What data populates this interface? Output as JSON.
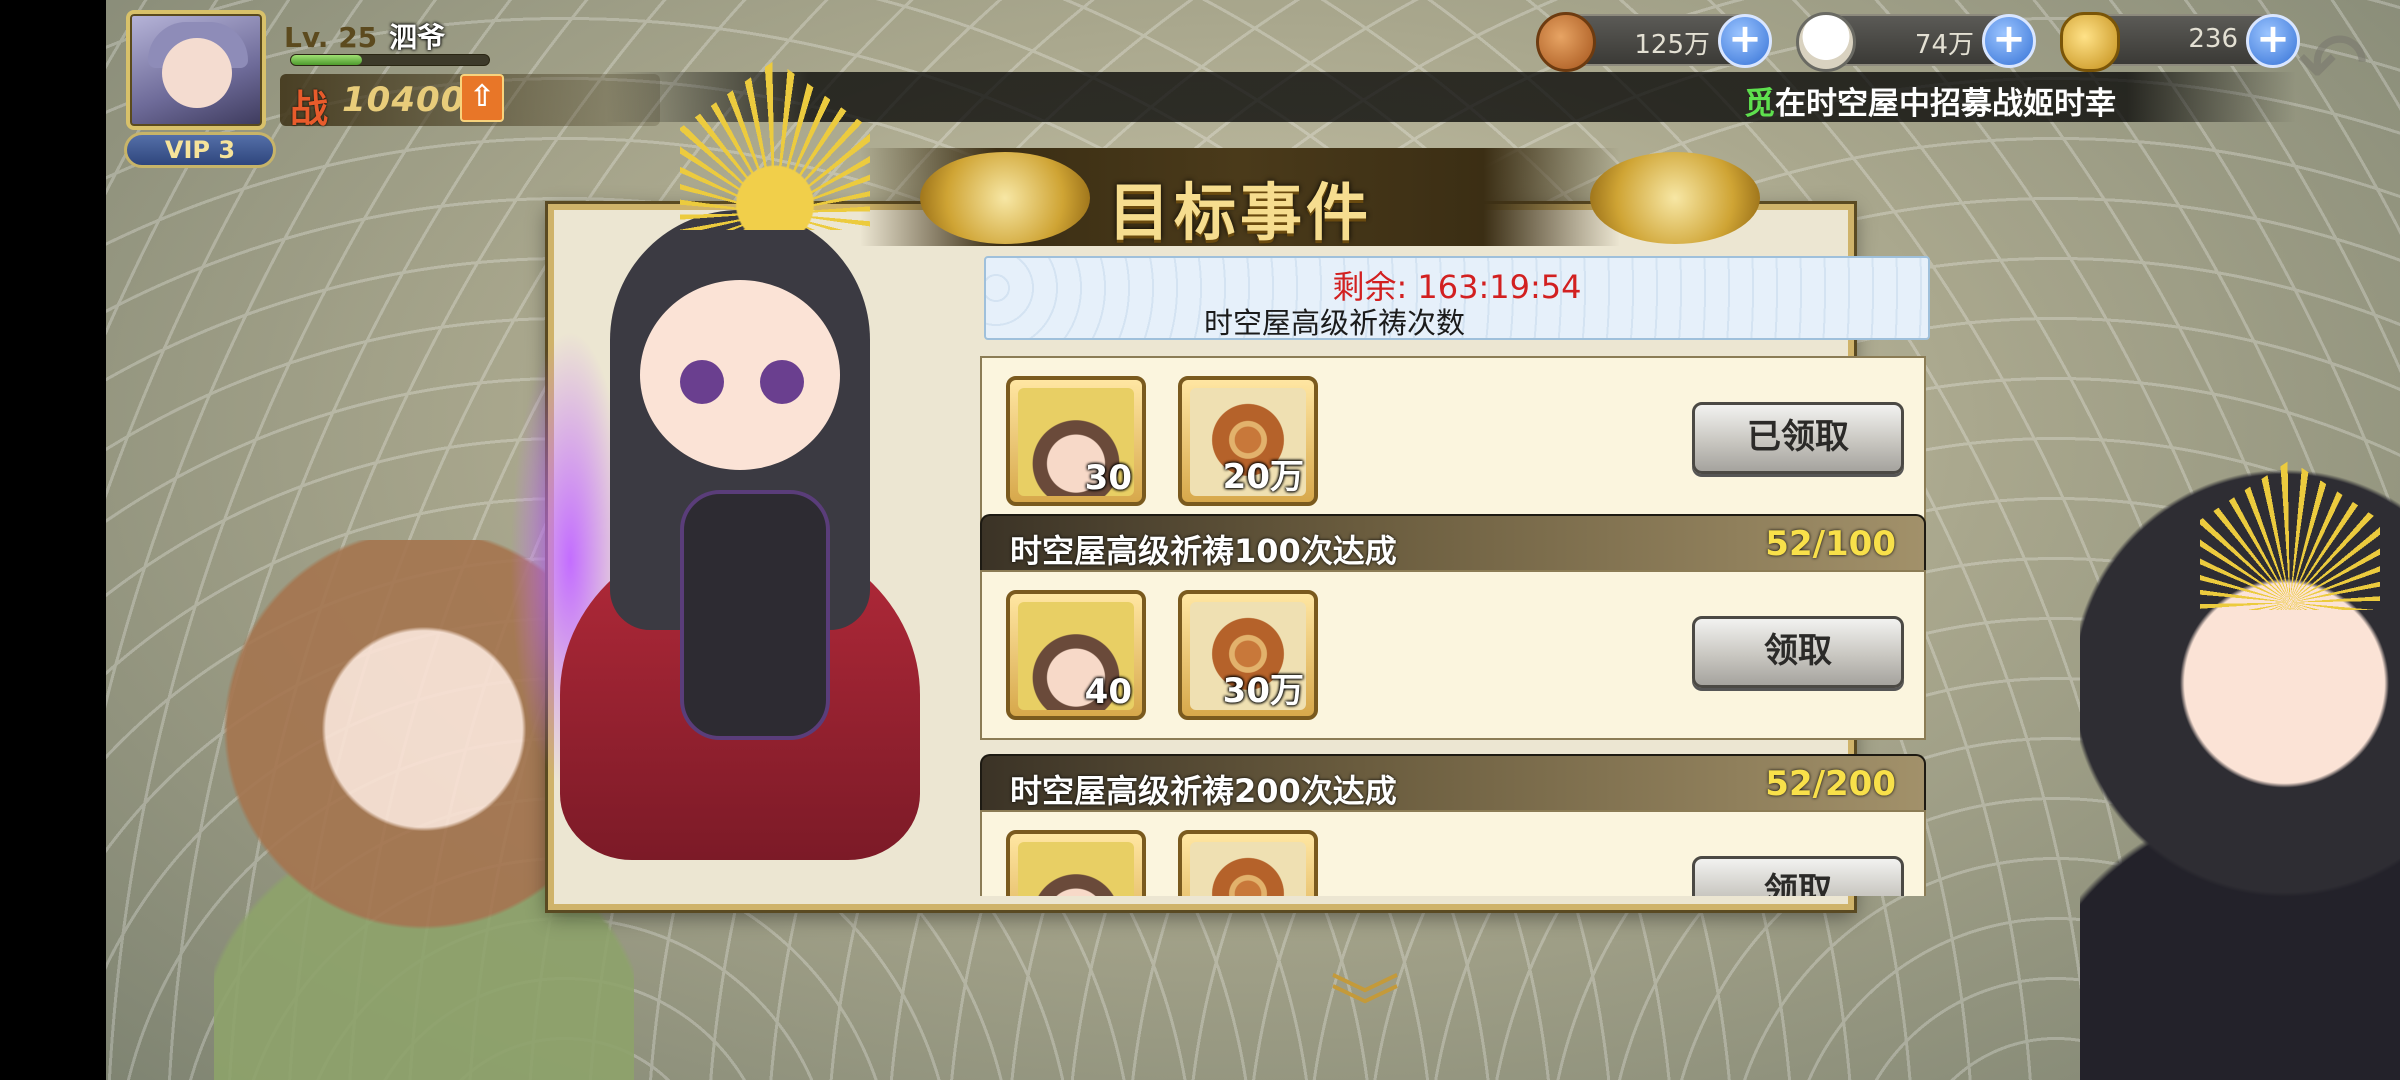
{
  "player": {
    "level_label": "Lv. 25",
    "name": "泗爷",
    "vip": "VIP 3",
    "power_icon": "战",
    "power_value": "104005",
    "exp_progress": 0.36
  },
  "resources": {
    "coins": "125万",
    "rice": "74万",
    "gold": "236"
  },
  "marquee": {
    "highlight": "觅",
    "text": "在时空屋中招募战姬时幸"
  },
  "dialog": {
    "title": "目标事件",
    "timer": "剩余: 163:19:54",
    "subtitle": "时空屋高级祈祷次数"
  },
  "tasks": [
    {
      "name": "",
      "progress": "",
      "rewards": [
        {
          "type": "hero",
          "qty": "30"
        },
        {
          "type": "coin",
          "qty": "20万"
        }
      ],
      "button": "已领取"
    },
    {
      "name": "时空屋高级祈祷100次达成",
      "progress": "52/100",
      "rewards": [
        {
          "type": "hero",
          "qty": "40"
        },
        {
          "type": "coin",
          "qty": "30万"
        }
      ],
      "button": "领取"
    },
    {
      "name": "时空屋高级祈祷200次达成",
      "progress": "52/200",
      "rewards": [
        {
          "type": "hero",
          "qty": ""
        },
        {
          "type": "coin",
          "qty": ""
        }
      ],
      "button": "领取"
    }
  ],
  "icons": {
    "plus": "+",
    "back": "↶",
    "power_up": "⇧",
    "scroll_down": "︾"
  }
}
